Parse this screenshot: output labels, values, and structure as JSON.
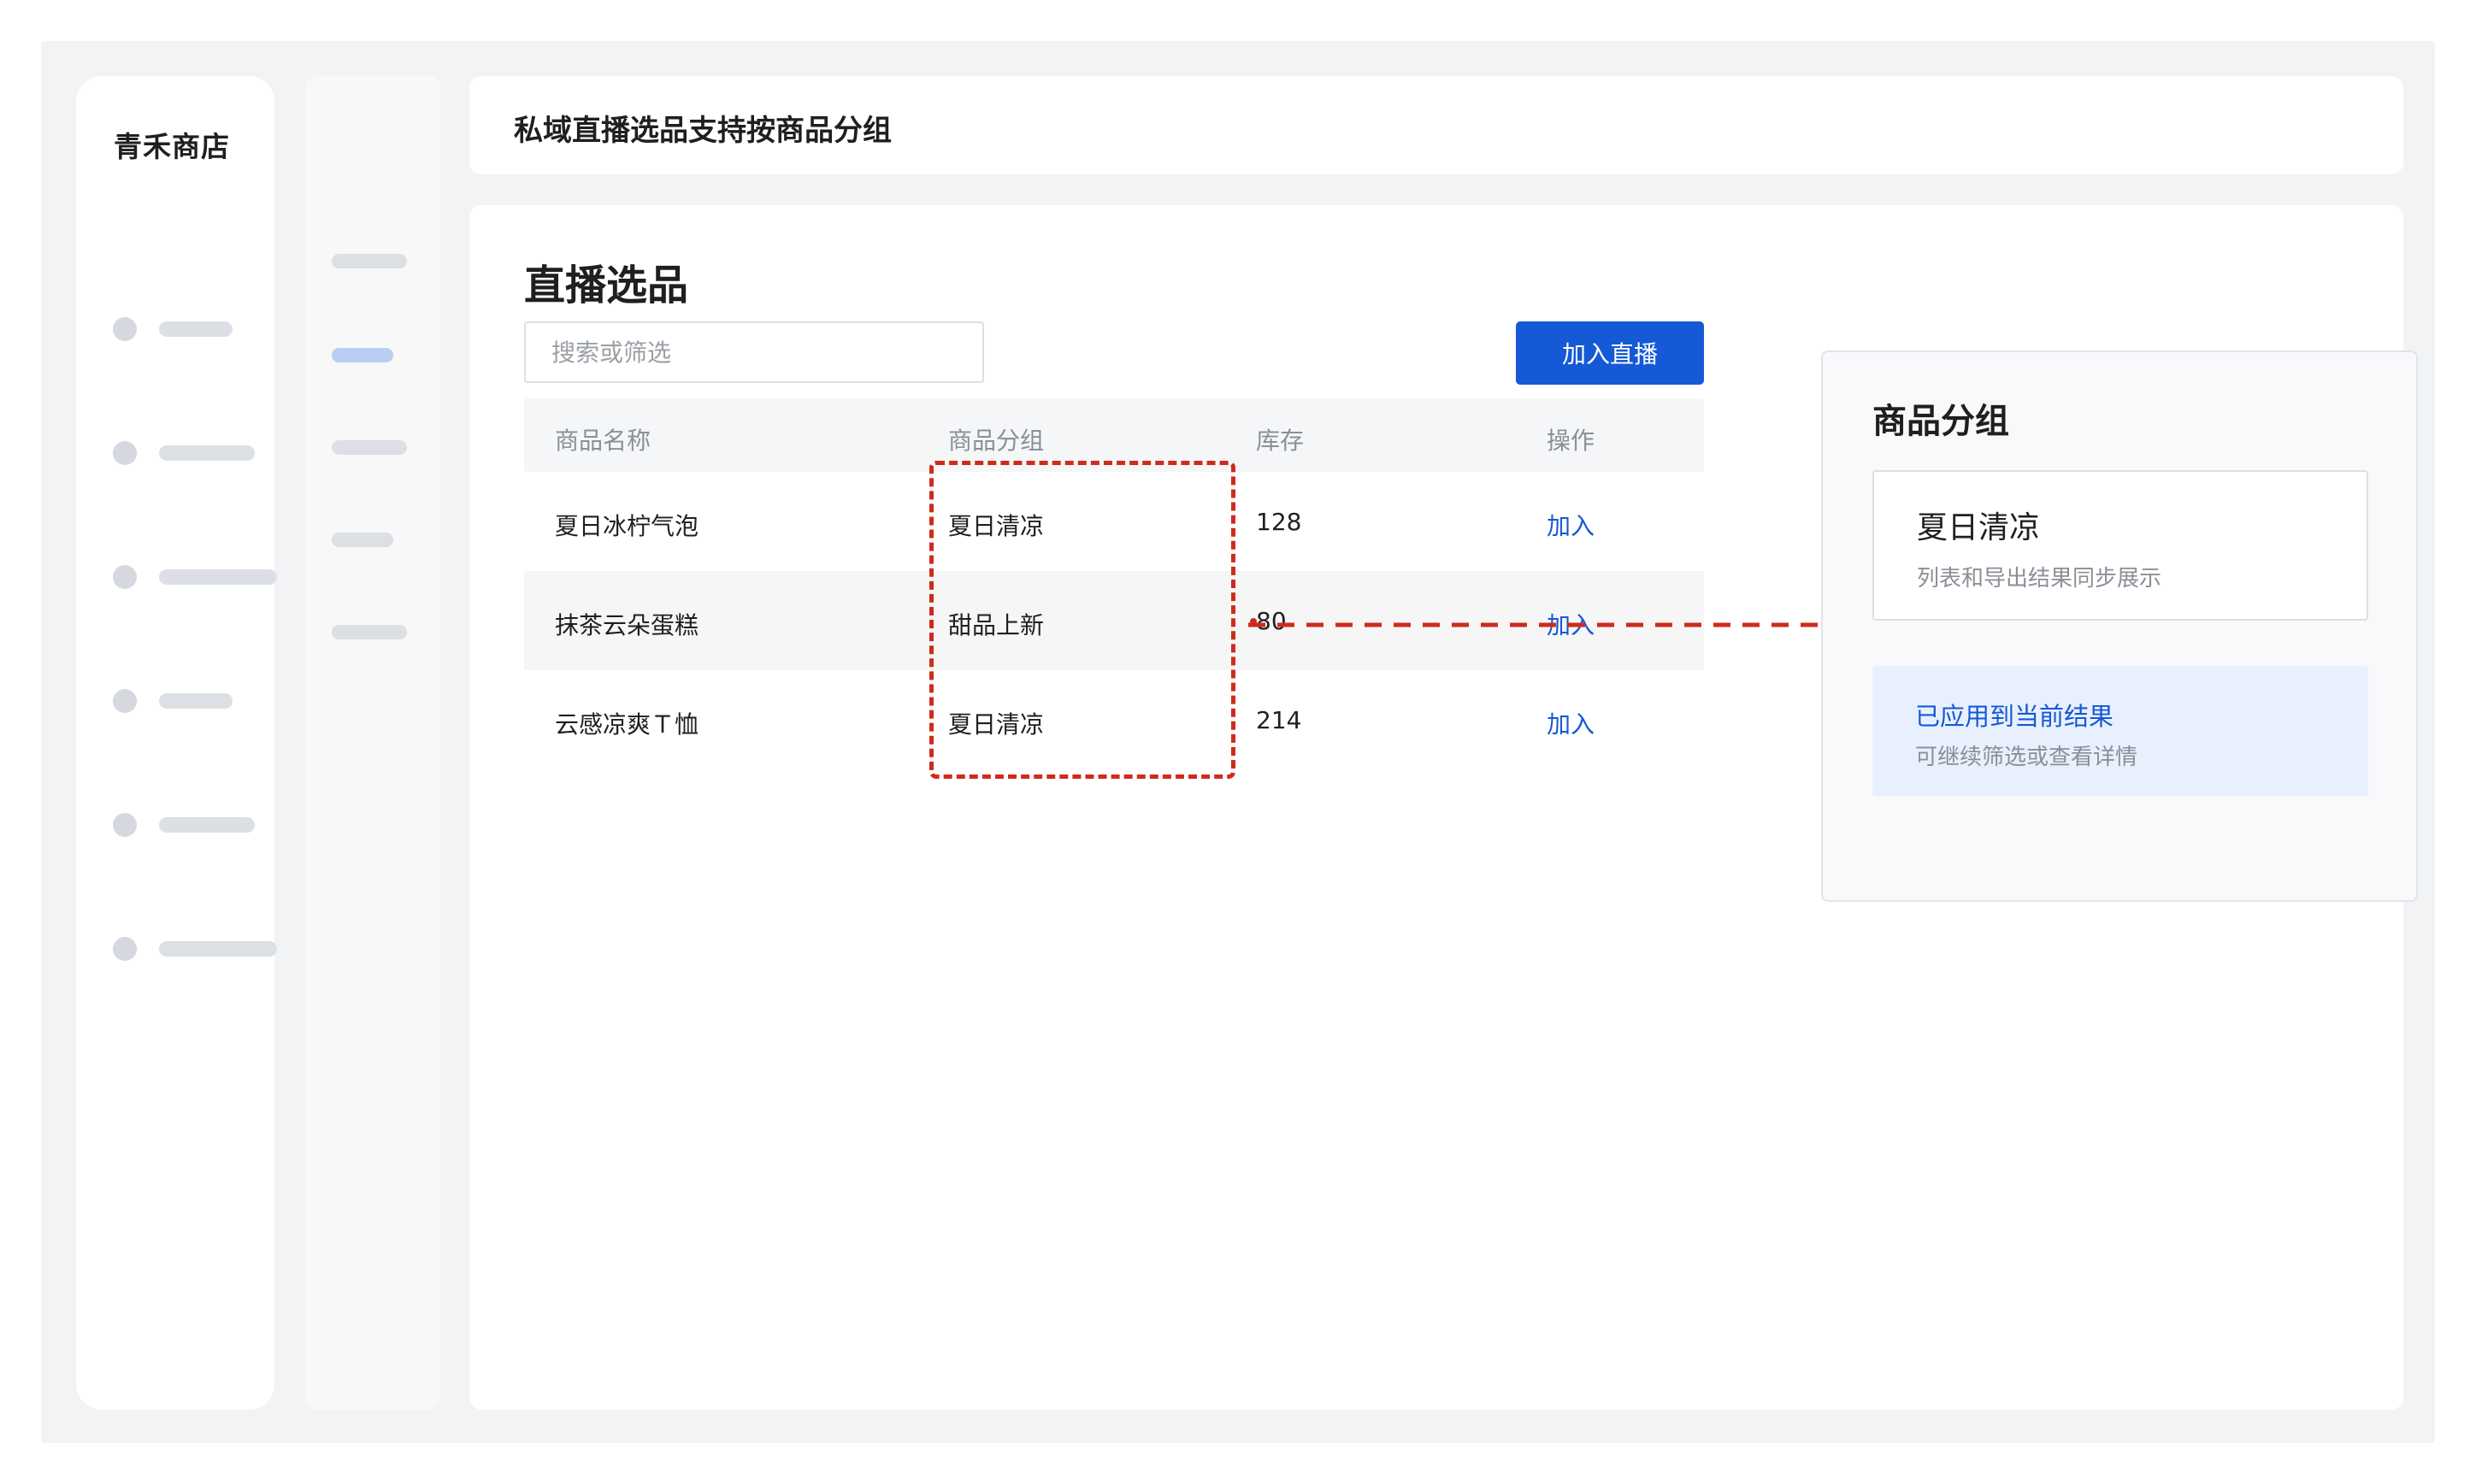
{
  "sidebar": {
    "brand": "青禾商店",
    "items": [
      {
        "icon": "nav-dot-icon"
      },
      {
        "icon": "nav-dot-icon"
      },
      {
        "icon": "nav-dot-icon"
      },
      {
        "icon": "nav-dot-icon"
      },
      {
        "icon": "nav-dot-icon"
      },
      {
        "icon": "nav-dot-icon"
      }
    ]
  },
  "header": {
    "title": "私域直播选品支持按商品分组"
  },
  "main": {
    "title": "直播选品",
    "search": {
      "placeholder": "搜索或筛选",
      "value": ""
    },
    "primary_button": "加入直播",
    "table": {
      "columns": [
        "商品名称",
        "商品分组",
        "库存",
        "操作"
      ],
      "rows": [
        {
          "name": "夏日冰柠气泡",
          "group": "夏日清凉",
          "stock": "128",
          "action": "加入"
        },
        {
          "name": "抹茶云朵蛋糕",
          "group": "甜品上新",
          "stock": "80",
          "action": "加入"
        },
        {
          "name": "云感凉爽Ｔ恤",
          "group": "夏日清凉",
          "stock": "214",
          "action": "加入"
        }
      ]
    }
  },
  "panel": {
    "title": "商品分组",
    "option": {
      "title": "夏日清凉",
      "subtitle": "列表和导出结果同步展示"
    },
    "status": {
      "title": "已应用到当前结果",
      "subtitle": "可继续筛选或查看详情"
    }
  },
  "colors": {
    "accent": "#1559d6",
    "annotation": "#cf2b1c",
    "frame_bg": "#f2f3f5",
    "status_bg": "#e9f0fd"
  }
}
